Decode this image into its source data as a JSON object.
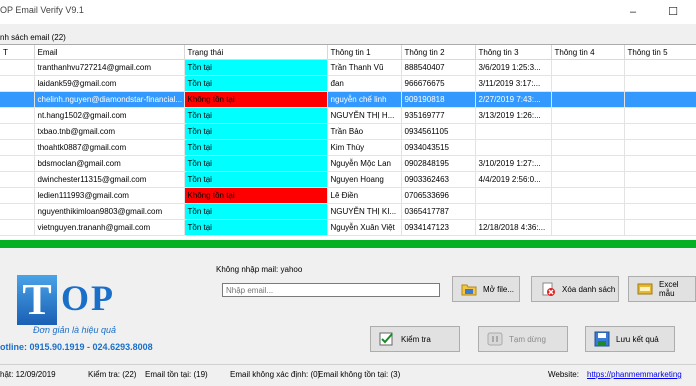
{
  "window": {
    "title": "OP Email Verify V9.1",
    "minimize": "–",
    "maximize": "☐"
  },
  "group_label": "nh sách email (22)",
  "table": {
    "columns": [
      "T",
      "Email",
      "Trạng thái",
      "Thông tin 1",
      "Thông tin 2",
      "Thông tin 3",
      "Thông tin 4",
      "Thông tin 5"
    ],
    "rows": [
      {
        "email": "tranthanhvu727214@gmail.com",
        "status": "Tồn tại",
        "s": "ok",
        "i1": "Trần Thanh Vũ",
        "i2": "888540407",
        "i3": "3/6/2019 1:25:3...",
        "i4": "",
        "i5": ""
      },
      {
        "email": "laidank59@gmail.com",
        "status": "Tồn tại",
        "s": "ok",
        "i1": "đan",
        "i2": "966676675",
        "i3": "3/11/2019 3:17:...",
        "i4": "",
        "i5": ""
      },
      {
        "email": "chelinh.nguyen@diamondstar-financial...",
        "status": "Không tồn tại",
        "s": "bad",
        "i1": "nguyễn chế linh",
        "i2": "909190818",
        "i3": "2/27/2019 7:43:...",
        "i4": "",
        "i5": "",
        "selected": true
      },
      {
        "email": "nt.hang1502@gmail.com",
        "status": "Tồn tại",
        "s": "ok",
        "i1": "NGUYỄN THỊ H...",
        "i2": "935169777",
        "i3": "3/13/2019 1:26:...",
        "i4": "",
        "i5": ""
      },
      {
        "email": "txbao.tnb@gmail.com",
        "status": "Tồn tại",
        "s": "ok",
        "i1": "Trần Bảo",
        "i2": "0934561105",
        "i3": "",
        "i4": "",
        "i5": ""
      },
      {
        "email": "thoahtk0887@gmail.com",
        "status": "Tồn tại",
        "s": "ok",
        "i1": "Kim Thùy",
        "i2": "0934043515",
        "i3": "",
        "i4": "",
        "i5": ""
      },
      {
        "email": "bdsmoclan@gmail.com",
        "status": "Tồn tại",
        "s": "ok",
        "i1": "Nguyễn Mộc Lan",
        "i2": "0902848195",
        "i3": "3/10/2019 1:27:...",
        "i4": "",
        "i5": ""
      },
      {
        "email": "dwinchester11315@gmail.com",
        "status": "Tồn tại",
        "s": "ok",
        "i1": "Nguyen Hoang",
        "i2": "0903362463",
        "i3": "4/4/2019 2:56:0...",
        "i4": "",
        "i5": ""
      },
      {
        "email": "ledien111993@gmail.com",
        "status": "Không tồn tại",
        "s": "bad",
        "i1": "Lê Điền",
        "i2": "0706533696",
        "i3": "",
        "i4": "",
        "i5": ""
      },
      {
        "email": "nguyenthikimloan9803@gmail.com",
        "status": "Tồn tại",
        "s": "ok",
        "i1": "NGUYỄN THỊ KI...",
        "i2": "0365417787",
        "i3": "",
        "i4": "",
        "i5": ""
      },
      {
        "email": "vietnguyen.trananh@gmail.com",
        "status": "Tồn tại",
        "s": "ok",
        "i1": "Nguyễn Xuân Việt",
        "i2": "0934147123",
        "i3": "12/18/2018 4:36:...",
        "i4": "",
        "i5": ""
      }
    ]
  },
  "colors": {
    "exists": "#00ffff",
    "not_exists": "#ff0000",
    "selected_row": "#3399ff",
    "progress": "#06b025",
    "brand": "#1a6fc9"
  },
  "progress_fraction": 1.0,
  "logo": {
    "t": "T",
    "op": "OP"
  },
  "slogan": "Đơn giản là hiệu quả",
  "hotline": "otline: 0915.90.1919 - 024.6293.8008",
  "skip_label": "Không nhập mail: yahoo",
  "email_input": {
    "placeholder": "Nhập email..."
  },
  "buttons": {
    "open_file": "Mở file...",
    "clear_list": "Xóa danh sách",
    "excel_template": "Excel mẫu",
    "check": "Kiểm tra",
    "stop": "Tạm dừng",
    "save": "Lưu kết quả"
  },
  "status": {
    "updated": "hật: 12/09/2019",
    "checked": "Kiểm tra: (22)",
    "exists": "Email tồn tại: (19)",
    "unknown": "Email không xác định: (0)",
    "not_exists": "Email không tồn tại: (3)",
    "website_label": "Website:",
    "website_url": "https://phanmemmarketing"
  }
}
